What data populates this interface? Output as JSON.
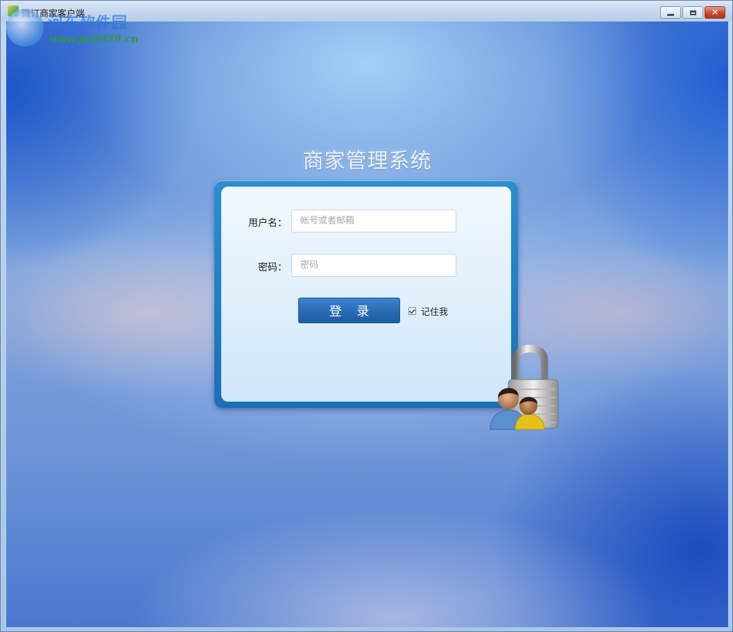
{
  "window": {
    "title": "微订商家客户端",
    "controls": {
      "minimize_icon": "minimize-icon",
      "maximize_icon": "maximize-icon",
      "close_icon": "close-icon"
    }
  },
  "watermark": {
    "title": "河东软件园",
    "url": "www.pc0359.cn"
  },
  "login": {
    "app_title": "商家管理系统",
    "username_label": "用户名：",
    "username_placeholder": "帐号或者邮箱",
    "username_value": "",
    "password_label": "密码：",
    "password_placeholder": "密码",
    "password_value": "",
    "login_button": "登 录",
    "remember_label": "记住我",
    "remember_checked": true
  },
  "colors": {
    "button_blue": "#2a6cb5",
    "panel_frame": "#1a6fb4",
    "close_red": "#c9452d"
  }
}
